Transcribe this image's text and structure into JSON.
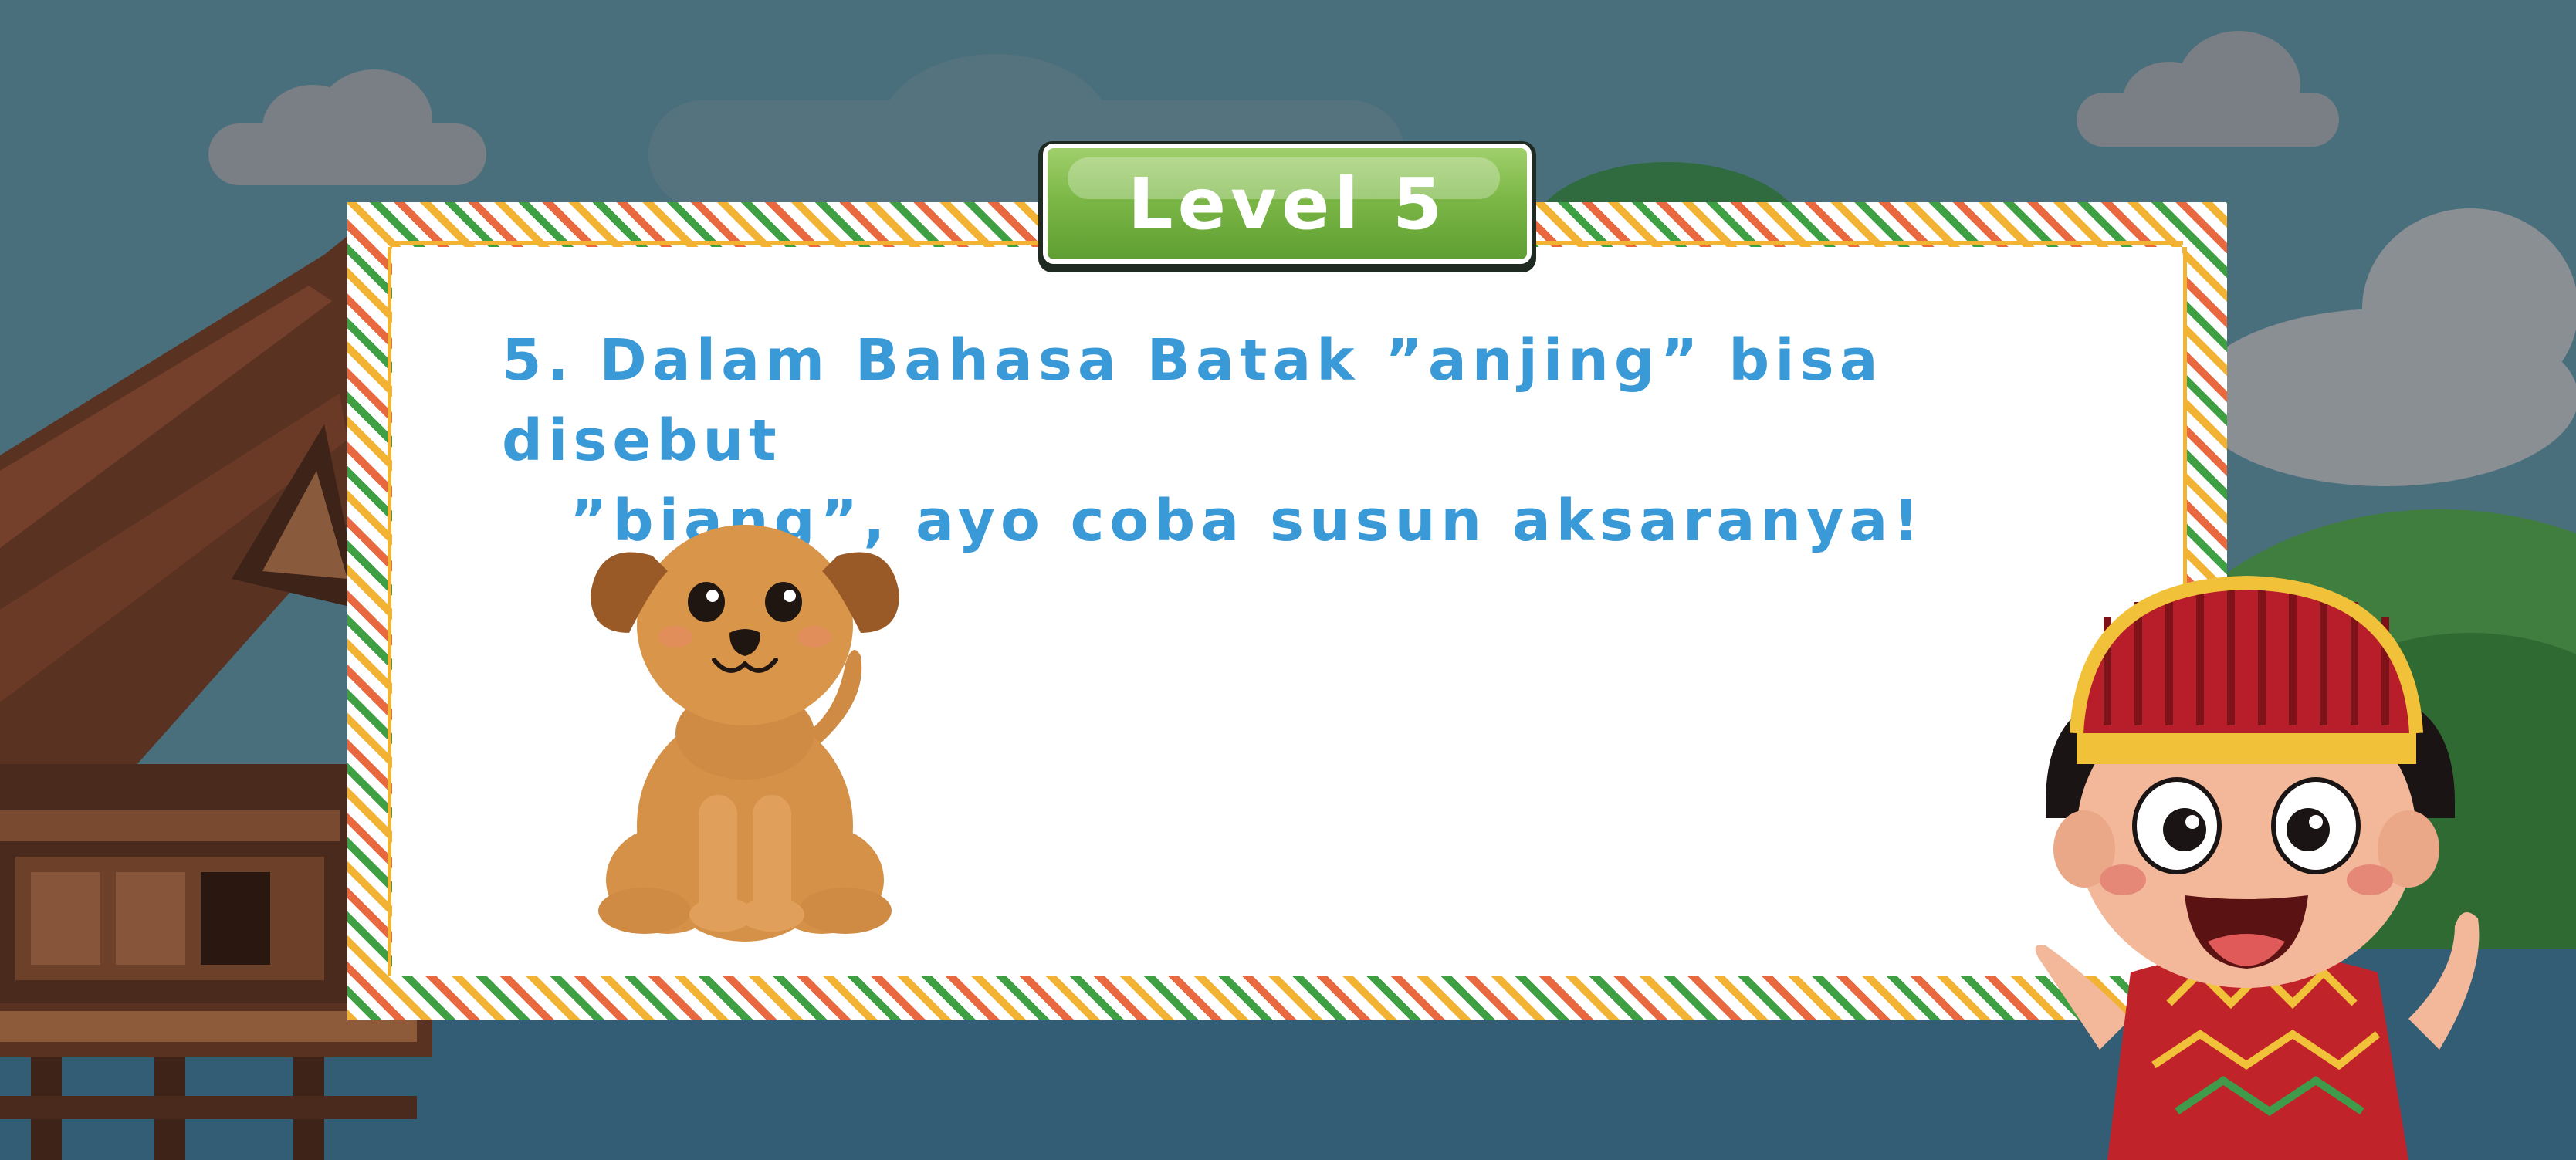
{
  "level": {
    "label": "Level 5"
  },
  "question": {
    "number": "5.",
    "line1": "Dalam Bahasa Batak ”anjing” bisa disebut",
    "line2": "”biang”, ayo coba susun aksaranya!"
  },
  "illustrations": {
    "animal": "dog",
    "character": "batak-boy-pointing",
    "house": "batak-traditional-house"
  },
  "colors": {
    "sky": "#4a6f7c",
    "lake": "#335d74",
    "question_text": "#3a9ad8",
    "level_badge": "#7cb847",
    "card": "#ffffff"
  }
}
